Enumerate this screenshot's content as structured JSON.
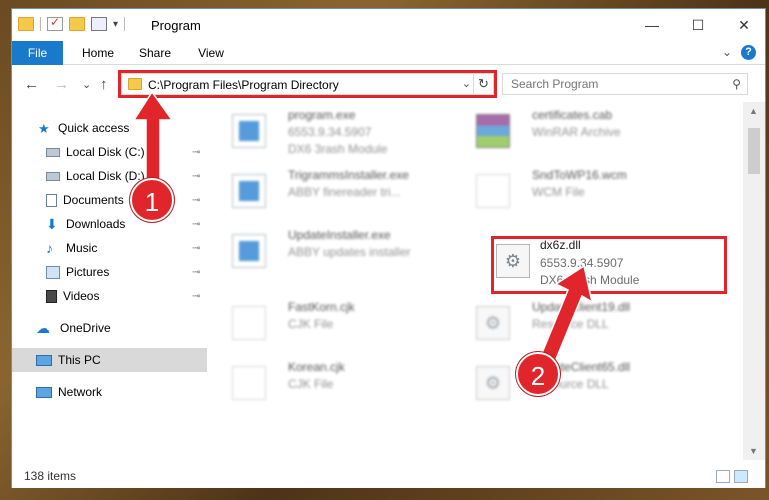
{
  "window": {
    "title": "Program",
    "minimize_glyph": "—",
    "maximize_glyph": "☐",
    "close_glyph": "✕"
  },
  "ribbon": {
    "tabs": [
      "File",
      "Home",
      "Share",
      "View"
    ],
    "expand_glyph": "⌄",
    "help_glyph": "?"
  },
  "nav": {
    "back_glyph": "←",
    "forward_glyph": "→",
    "recent_glyph": "⌄",
    "up_glyph": "↑"
  },
  "address": {
    "path": "C:\\Program Files\\Program Directory",
    "dropdown_glyph": "⌄",
    "refresh_glyph": "↻"
  },
  "search": {
    "placeholder": "Search Program",
    "icon_glyph": "⚲"
  },
  "sidebar": {
    "items": [
      {
        "label": "Quick access",
        "icon": "star-icon",
        "pinned": false
      },
      {
        "label": "Local Disk (C:)",
        "icon": "drive-icon",
        "pinned": true
      },
      {
        "label": "Local Disk (D:)",
        "icon": "drive-icon",
        "pinned": true
      },
      {
        "label": "Documents",
        "icon": "documents-icon",
        "pinned": true
      },
      {
        "label": "Downloads",
        "icon": "download-icon",
        "pinned": true
      },
      {
        "label": "Music",
        "icon": "music-icon",
        "pinned": true
      },
      {
        "label": "Pictures",
        "icon": "pictures-icon",
        "pinned": true
      },
      {
        "label": "Videos",
        "icon": "videos-icon",
        "pinned": true
      },
      {
        "label": "OneDrive",
        "icon": "cloud-icon",
        "pinned": false
      },
      {
        "label": "This PC",
        "icon": "computer-icon",
        "pinned": false,
        "selected": true
      },
      {
        "label": "Network",
        "icon": "network-icon",
        "pinned": false
      }
    ],
    "pin_glyph": "📌"
  },
  "files": [
    {
      "name": "program.exe",
      "line2": "6553.9.34.5907",
      "line3": "DX6 3rash Module",
      "icon": "program-icon"
    },
    {
      "name": "certificates.cab",
      "line2": "WinRAR Archive",
      "line3": "",
      "icon": "archive-icon"
    },
    {
      "name": "TrigrammsInstaller.exe",
      "line2": "ABBY finereader tri...",
      "line3": "",
      "icon": "installer-icon"
    },
    {
      "name": "SndToWP16.wcm",
      "line2": "WCM File",
      "line3": "",
      "icon": "document-icon"
    },
    {
      "name": "UpdateInstaller.exe",
      "line2": "ABBY updates installer",
      "line3": "",
      "icon": "installer-icon"
    },
    {
      "name": "dx6z.dll",
      "line2": "6553.9.34.5907",
      "line3": "DX6 3rash Module",
      "icon": "dll-gear-icon"
    },
    {
      "name": "FastKorn.cjk",
      "line2": "CJK File",
      "line3": "",
      "icon": "document-icon"
    },
    {
      "name": "UpdateClient19.dll",
      "line2": "Resource DLL",
      "line3": "",
      "icon": "dll-gear-icon"
    },
    {
      "name": "Korean.cjk",
      "line2": "CJK File",
      "line3": "",
      "icon": "document-icon"
    },
    {
      "name": "UpdateClient65.dll",
      "line2": "Resource DLL",
      "line3": "",
      "icon": "dll-gear-icon"
    }
  ],
  "status": {
    "item_count": "138 items"
  },
  "callouts": [
    "1",
    "2"
  ],
  "colors": {
    "accent": "#1979ca",
    "highlight_red": "#e0252b"
  }
}
